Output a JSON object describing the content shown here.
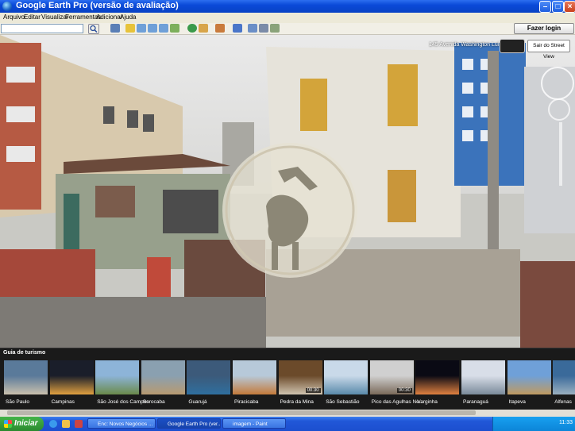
{
  "window": {
    "title": "Google Earth Pro (versão de avaliação)"
  },
  "menu": [
    "Arquivo",
    "Editar",
    "Visualizar",
    "Ferramentas",
    "Adicionar",
    "Ajuda"
  ],
  "toolbar": {
    "search_icon": "magnifier-icon",
    "login_label": "Fazer login"
  },
  "streetview": {
    "address": "145 Avenida Washington Luís",
    "exit_label": "Sair do Street View"
  },
  "guide": {
    "title": "Guia de turismo",
    "items": [
      {
        "label": "São Paulo",
        "badge": ""
      },
      {
        "label": "Campinas",
        "badge": ""
      },
      {
        "label": "São José dos Campos",
        "badge": ""
      },
      {
        "label": "Sorocaba",
        "badge": ""
      },
      {
        "label": "Guarujá",
        "badge": ""
      },
      {
        "label": "Piracicaba",
        "badge": ""
      },
      {
        "label": "Pedra da Mina",
        "badge": "00:30"
      },
      {
        "label": "São Sebastião",
        "badge": ""
      },
      {
        "label": "Pico das Agulhas Ne...",
        "badge": "00:30"
      },
      {
        "label": "Varginha",
        "badge": ""
      },
      {
        "label": "Paranaguá",
        "badge": ""
      },
      {
        "label": "Itapeva",
        "badge": ""
      },
      {
        "label": "Alfenas",
        "badge": ""
      }
    ]
  },
  "taskbar": {
    "start_label": "Iniciar",
    "tasks": [
      "Enc: Novos Negócios ...",
      "Google Earth Pro (ver...",
      "imagem - Paint"
    ],
    "clock": "11:33"
  },
  "colors": {
    "titlebar": "#0a4ad8",
    "taskbar": "#2157d8",
    "start": "#2b8a2f"
  }
}
